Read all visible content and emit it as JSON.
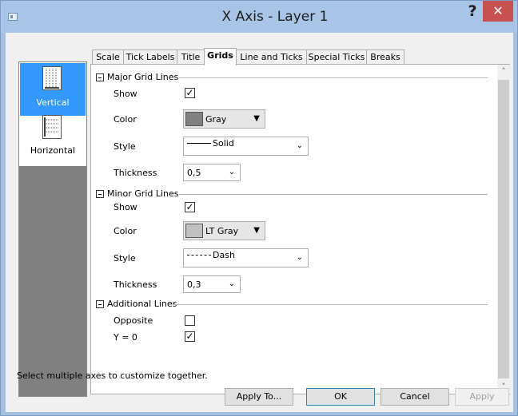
{
  "window": {
    "title": "X Axis - Layer 1",
    "help": "?",
    "close": "✕"
  },
  "axis_list": [
    {
      "label": "Vertical",
      "selected": true
    },
    {
      "label": "Horizontal",
      "selected": false
    }
  ],
  "tabs": [
    {
      "label": "Scale",
      "active": false
    },
    {
      "label": "Tick Labels",
      "active": false
    },
    {
      "label": "Title",
      "active": false
    },
    {
      "label": "Grids",
      "active": true
    },
    {
      "label": "Line and Ticks",
      "active": false
    },
    {
      "label": "Special Ticks",
      "active": false
    },
    {
      "label": "Breaks",
      "active": false
    }
  ],
  "major": {
    "header": "Major Grid Lines",
    "show_label": "Show",
    "show_checked": true,
    "check_mark": "✓",
    "color_label": "Color",
    "color_value": "Gray",
    "color_hex": "#808080",
    "style_label": "Style",
    "style_value": "Solid",
    "thickness_label": "Thickness",
    "thickness_value": "0,5"
  },
  "minor": {
    "header": "Minor Grid Lines",
    "show_label": "Show",
    "show_checked": true,
    "check_mark": "✓",
    "color_label": "Color",
    "color_value": "LT Gray",
    "color_hex": "#c0c0c0",
    "style_label": "Style",
    "style_value": "Dash",
    "thickness_label": "Thickness",
    "thickness_value": "0,3"
  },
  "additional": {
    "header": "Additional Lines",
    "opposite_label": "Opposite",
    "opposite_checked": false,
    "y0_label": "Y = 0",
    "y0_checked": true,
    "check_mark": "✓"
  },
  "hint": "Select multiple axes to customize together.",
  "buttons": {
    "apply_to": "Apply To...",
    "ok": "OK",
    "cancel": "Cancel",
    "apply": "Apply"
  },
  "arrows": {
    "down": "▼",
    "chevron_down": "⌄",
    "scroll_up": "˄",
    "scroll_down": "˅"
  }
}
